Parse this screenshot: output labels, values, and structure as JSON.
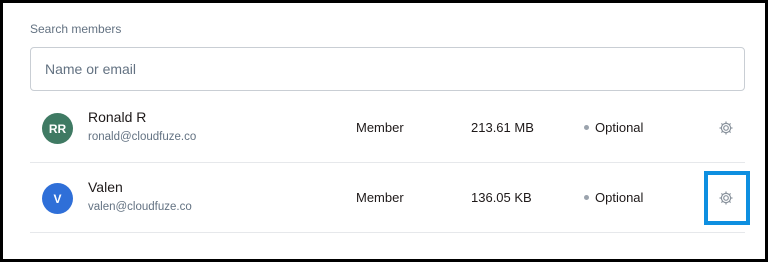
{
  "search": {
    "label": "Search members",
    "placeholder": "Name or email"
  },
  "members": [
    {
      "initials": "RR",
      "avatar_color": "#3f7a63",
      "name": "Ronald R",
      "email": "ronald@cloudfuze.co",
      "role": "Member",
      "storage": "213.61 MB",
      "status": "Optional",
      "settings_icon": "gear-icon"
    },
    {
      "initials": "V",
      "avatar_color": "#2f6fd8",
      "name": "Valen",
      "email": "valen@cloudfuze.co",
      "role": "Member",
      "storage": "136.05 KB",
      "status": "Optional",
      "settings_icon": "gear-icon",
      "highlighted": true
    }
  ],
  "colors": {
    "highlight": "#0e8fe0",
    "status_dot": "#9ba3ad"
  }
}
